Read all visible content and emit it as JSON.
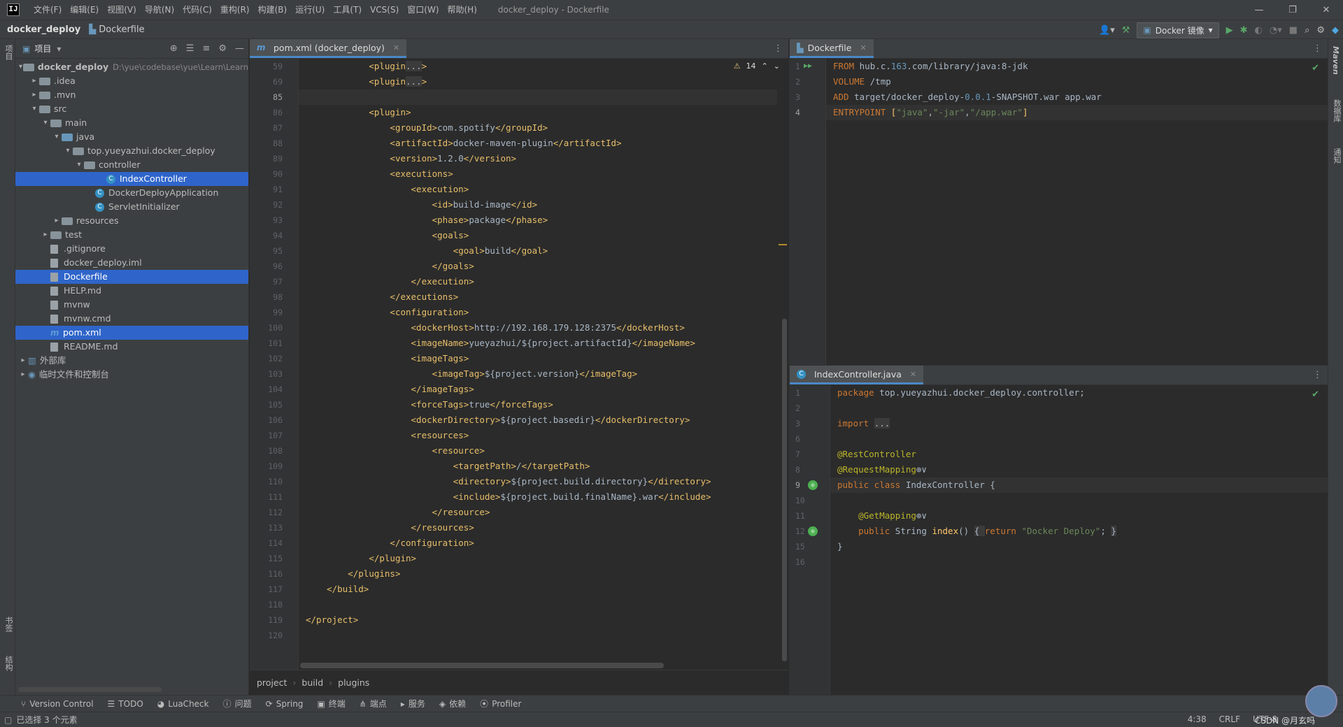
{
  "menubar": {
    "logo": "IJ",
    "items": [
      "文件(F)",
      "编辑(E)",
      "视图(V)",
      "导航(N)",
      "代码(C)",
      "重构(R)",
      "构建(B)",
      "运行(U)",
      "工具(T)",
      "VCS(S)",
      "窗口(W)",
      "帮助(H)"
    ],
    "window_title": "docker_deploy - Dockerfile"
  },
  "navbar": {
    "project": "docker_deploy",
    "file": "Dockerfile",
    "run_config": "Docker 镜像"
  },
  "left_strip": {
    "top": "项目",
    "mid": "书签",
    "bottom": "结构"
  },
  "right_strip": {
    "maven": "Maven",
    "db": "数据库",
    "notify": "通知"
  },
  "project": {
    "title": "项目",
    "tree": [
      {
        "label": "docker_deploy",
        "extra": "D:\\yue\\codebase\\yue\\Learn\\Learn",
        "indent": 0,
        "arrow": "▾",
        "type": "folder",
        "bold": true
      },
      {
        "label": ".idea",
        "indent": 1,
        "arrow": "▸",
        "type": "folder"
      },
      {
        "label": ".mvn",
        "indent": 1,
        "arrow": "▸",
        "type": "folder"
      },
      {
        "label": "src",
        "indent": 1,
        "arrow": "▾",
        "type": "folder"
      },
      {
        "label": "main",
        "indent": 2,
        "arrow": "▾",
        "type": "folder"
      },
      {
        "label": "java",
        "indent": 3,
        "arrow": "▾",
        "type": "folder-blue"
      },
      {
        "label": "top.yueyazhui.docker_deploy",
        "indent": 4,
        "arrow": "▾",
        "type": "folder"
      },
      {
        "label": "controller",
        "indent": 5,
        "arrow": "▾",
        "type": "folder"
      },
      {
        "label": "IndexController",
        "indent": 7,
        "arrow": "",
        "type": "class",
        "selected": true
      },
      {
        "label": "DockerDeployApplication",
        "indent": 6,
        "arrow": "",
        "type": "class"
      },
      {
        "label": "ServletInitializer",
        "indent": 6,
        "arrow": "",
        "type": "class"
      },
      {
        "label": "resources",
        "indent": 3,
        "arrow": "▸",
        "type": "folder"
      },
      {
        "label": "test",
        "indent": 2,
        "arrow": "▸",
        "type": "folder"
      },
      {
        "label": ".gitignore",
        "indent": 2,
        "arrow": "",
        "type": "file"
      },
      {
        "label": "docker_deploy.iml",
        "indent": 2,
        "arrow": "",
        "type": "file"
      },
      {
        "label": "Dockerfile",
        "indent": 2,
        "arrow": "",
        "type": "file",
        "selected": true
      },
      {
        "label": "HELP.md",
        "indent": 2,
        "arrow": "",
        "type": "file"
      },
      {
        "label": "mvnw",
        "indent": 2,
        "arrow": "",
        "type": "file"
      },
      {
        "label": "mvnw.cmd",
        "indent": 2,
        "arrow": "",
        "type": "file"
      },
      {
        "label": "pom.xml",
        "indent": 2,
        "arrow": "",
        "type": "maven",
        "selected": true
      },
      {
        "label": "README.md",
        "indent": 2,
        "arrow": "",
        "type": "file"
      },
      {
        "label": "外部库",
        "indent": 0,
        "arrow": "▸",
        "type": "lib"
      },
      {
        "label": "临时文件和控制台",
        "indent": 0,
        "arrow": "▸",
        "type": "scratch"
      }
    ]
  },
  "editor_pom": {
    "tab": "pom.xml (docker_deploy)",
    "warnings": "14",
    "breadcrumbs": [
      "project",
      "build",
      "plugins"
    ],
    "line_numbers": [
      "59",
      "69",
      "85",
      "86",
      "87",
      "88",
      "89",
      "90",
      "91",
      "92",
      "93",
      "94",
      "95",
      "96",
      "97",
      "98",
      "99",
      "100",
      "101",
      "102",
      "103",
      "104",
      "105",
      "106",
      "107",
      "108",
      "109",
      "110",
      "111",
      "112",
      "113",
      "114",
      "115",
      "116",
      "117",
      "118",
      "119",
      "120"
    ],
    "lines": [
      {
        "i": 3,
        "pre": "<plugin",
        "fold": "...",
        "post": ">"
      },
      {
        "i": 3,
        "pre": "<plugin",
        "fold": "...",
        "post": ">"
      },
      {
        "i": 0,
        "pre": ""
      },
      {
        "i": 3,
        "pre": "<plugin>"
      },
      {
        "i": 4,
        "pre": "<groupId>",
        "t": "com.spotify",
        "post": "</groupId>"
      },
      {
        "i": 4,
        "pre": "<artifactId>",
        "t": "docker-maven-plugin",
        "post": "</artifactId>"
      },
      {
        "i": 4,
        "pre": "<version>",
        "t": "1.2.0",
        "post": "</version>"
      },
      {
        "i": 4,
        "pre": "<executions>"
      },
      {
        "i": 5,
        "pre": "<execution>"
      },
      {
        "i": 6,
        "pre": "<id>",
        "t": "build-image",
        "post": "</id>"
      },
      {
        "i": 6,
        "pre": "<phase>",
        "t": "package",
        "post": "</phase>"
      },
      {
        "i": 6,
        "pre": "<goals>"
      },
      {
        "i": 7,
        "pre": "<goal>",
        "t": "build",
        "post": "</goal>"
      },
      {
        "i": 6,
        "pre": "</goals>"
      },
      {
        "i": 5,
        "pre": "</execution>"
      },
      {
        "i": 4,
        "pre": "</executions>"
      },
      {
        "i": 4,
        "pre": "<configuration>"
      },
      {
        "i": 5,
        "pre": "<dockerHost>",
        "t": "http://192.168.179.128:2375",
        "post": "</dockerHost>"
      },
      {
        "i": 5,
        "pre": "<imageName>",
        "t": "yueyazhui/${project.artifactId}",
        "post": "</imageName>"
      },
      {
        "i": 5,
        "pre": "<imageTags>"
      },
      {
        "i": 6,
        "pre": "<imageTag>",
        "t": "${project.version}",
        "post": "</imageTag>"
      },
      {
        "i": 5,
        "pre": "</imageTags>"
      },
      {
        "i": 5,
        "pre": "<forceTags>",
        "t": "true",
        "post": "</forceTags>"
      },
      {
        "i": 5,
        "pre": "<dockerDirectory>",
        "t": "${project.basedir}",
        "post": "</dockerDirectory>"
      },
      {
        "i": 5,
        "pre": "<resources>"
      },
      {
        "i": 6,
        "pre": "<resource>"
      },
      {
        "i": 7,
        "pre": "<targetPath>",
        "t": "/",
        "post": "</targetPath>"
      },
      {
        "i": 7,
        "pre": "<directory>",
        "t": "${project.build.directory}",
        "post": "</directory>"
      },
      {
        "i": 7,
        "pre": "<include>",
        "t": "${project.build.finalName}.war",
        "post": "</include>"
      },
      {
        "i": 6,
        "pre": "</resource>"
      },
      {
        "i": 5,
        "pre": "</resources>"
      },
      {
        "i": 4,
        "pre": "</configuration>"
      },
      {
        "i": 3,
        "pre": "</plugin>"
      },
      {
        "i": 2,
        "pre": "</plugins>"
      },
      {
        "i": 1,
        "pre": "</build>"
      },
      {
        "i": 0,
        "pre": ""
      },
      {
        "i": 0,
        "pre": "</project>"
      },
      {
        "i": 0,
        "pre": ""
      }
    ]
  },
  "editor_docker": {
    "tab": "Dockerfile",
    "line_numbers": [
      "1",
      "2",
      "3",
      "4"
    ],
    "lines": [
      [
        {
          "c": "kw",
          "t": "FROM "
        },
        {
          "c": "plain",
          "t": "hub.c."
        },
        {
          "c": "num",
          "t": "163"
        },
        {
          "c": "plain",
          "t": ".com/library/java:8-jdk"
        }
      ],
      [
        {
          "c": "kw",
          "t": "VOLUME "
        },
        {
          "c": "plain",
          "t": "/tmp"
        }
      ],
      [
        {
          "c": "kw",
          "t": "ADD "
        },
        {
          "c": "plain",
          "t": "target/docker_deploy-"
        },
        {
          "c": "num",
          "t": "0.0.1"
        },
        {
          "c": "plain",
          "t": "-SNAPSHOT.war app.war"
        }
      ],
      [
        {
          "c": "kw",
          "t": "ENTRYPOINT "
        },
        {
          "c": "fn",
          "t": "["
        },
        {
          "c": "str",
          "t": "\"java\""
        },
        {
          "c": "plain",
          "t": ","
        },
        {
          "c": "str",
          "t": "\"-jar\""
        },
        {
          "c": "plain",
          "t": ","
        },
        {
          "c": "str",
          "t": "\"/app.war\""
        },
        {
          "c": "fn",
          "t": "]"
        }
      ]
    ]
  },
  "editor_java": {
    "tab": "IndexController.java",
    "line_numbers": [
      "1",
      "2",
      "3",
      "6",
      "7",
      "8",
      "9",
      "10",
      "11",
      "12",
      "15",
      "16"
    ],
    "lines": [
      [
        {
          "c": "kw",
          "t": "package "
        },
        {
          "c": "plain",
          "t": "top.yueyazhui.docker_deploy.controller;"
        }
      ],
      [],
      [
        {
          "c": "kw",
          "t": "import "
        },
        {
          "c": "fold",
          "t": "..."
        }
      ],
      [],
      [
        {
          "c": "ann",
          "t": "@RestController"
        }
      ],
      [
        {
          "c": "ann",
          "t": "@RequestMapping"
        },
        {
          "c": "plain",
          "t": "⊕∨"
        }
      ],
      [
        {
          "c": "kw",
          "t": "public class "
        },
        {
          "c": "cls",
          "t": "IndexController "
        },
        {
          "c": "plain",
          "t": "{"
        }
      ],
      [],
      [
        {
          "c": "plain",
          "t": "    "
        },
        {
          "c": "ann",
          "t": "@GetMapping"
        },
        {
          "c": "plain",
          "t": "⊕∨"
        }
      ],
      [
        {
          "c": "plain",
          "t": "    "
        },
        {
          "c": "kw",
          "t": "public "
        },
        {
          "c": "plain",
          "t": "String "
        },
        {
          "c": "fn",
          "t": "index"
        },
        {
          "c": "plain",
          "t": "() "
        },
        {
          "c": "fold",
          "t": "{ "
        },
        {
          "c": "kw",
          "t": "return "
        },
        {
          "c": "str",
          "t": "\"Docker Deploy\""
        },
        {
          "c": "plain",
          "t": "; "
        },
        {
          "c": "fold",
          "t": "}"
        }
      ],
      [
        {
          "c": "plain",
          "t": "}"
        }
      ],
      []
    ]
  },
  "bottom_tools": [
    "Version Control",
    "TODO",
    "LuaCheck",
    "问题",
    "Spring",
    "终端",
    "端点",
    "服务",
    "依赖",
    "Profiler"
  ],
  "status": {
    "message": "已选择 3 个元素",
    "position": "4:38",
    "line_sep": "CRLF",
    "encoding": "UTF-8",
    "watermark": "CSDN @月玄吗"
  }
}
